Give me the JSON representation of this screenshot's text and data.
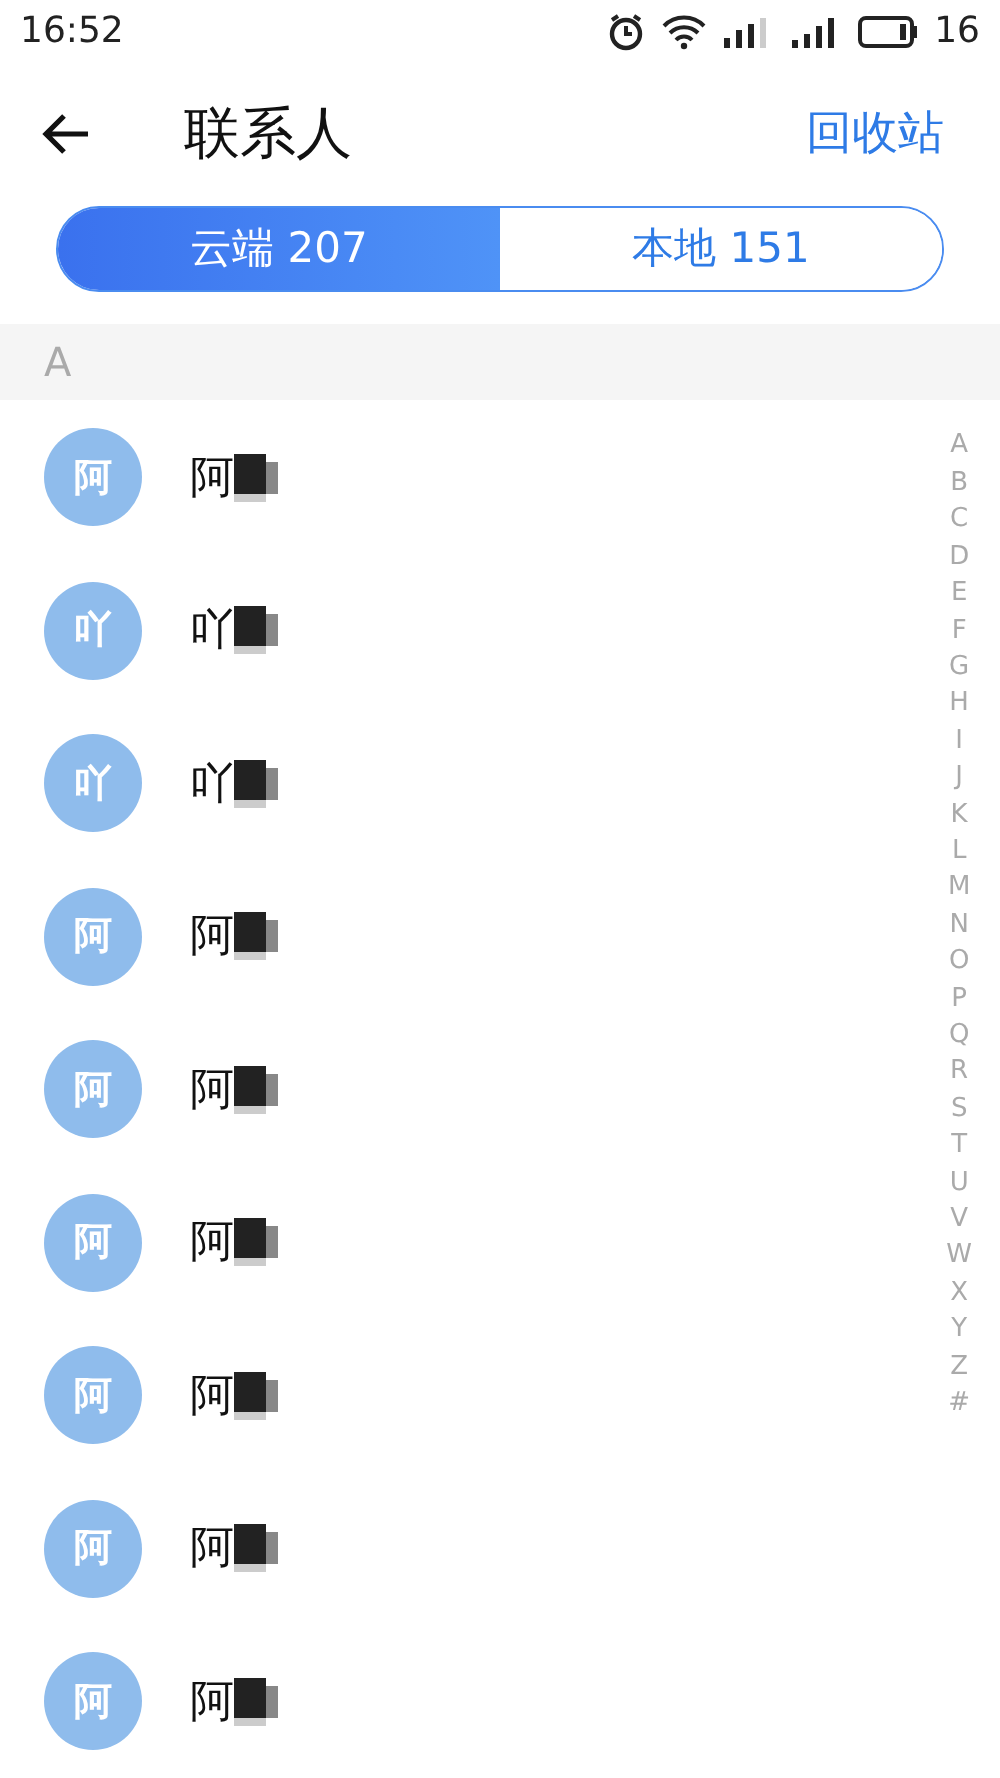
{
  "status_bar": {
    "time": "16:52",
    "battery_text": "16"
  },
  "toolbar": {
    "title": "联系人",
    "action": "回收站"
  },
  "tabs": [
    {
      "label": "云端 207",
      "selected": true
    },
    {
      "label": "本地 151",
      "selected": false
    }
  ],
  "section": "A",
  "contacts": [
    {
      "avatar": "阿",
      "name": "阿"
    },
    {
      "avatar": "吖",
      "name": "吖"
    },
    {
      "avatar": "吖",
      "name": "吖"
    },
    {
      "avatar": "阿",
      "name": "阿"
    },
    {
      "avatar": "阿",
      "name": "阿"
    },
    {
      "avatar": "阿",
      "name": "阿"
    },
    {
      "avatar": "阿",
      "name": "阿"
    },
    {
      "avatar": "阿",
      "name": "阿"
    },
    {
      "avatar": "阿",
      "name": "阿"
    }
  ],
  "index": [
    "A",
    "B",
    "C",
    "D",
    "E",
    "F",
    "G",
    "H",
    "I",
    "J",
    "K",
    "L",
    "M",
    "N",
    "O",
    "P",
    "Q",
    "R",
    "S",
    "T",
    "U",
    "V",
    "W",
    "X",
    "Y",
    "Z",
    "#"
  ]
}
